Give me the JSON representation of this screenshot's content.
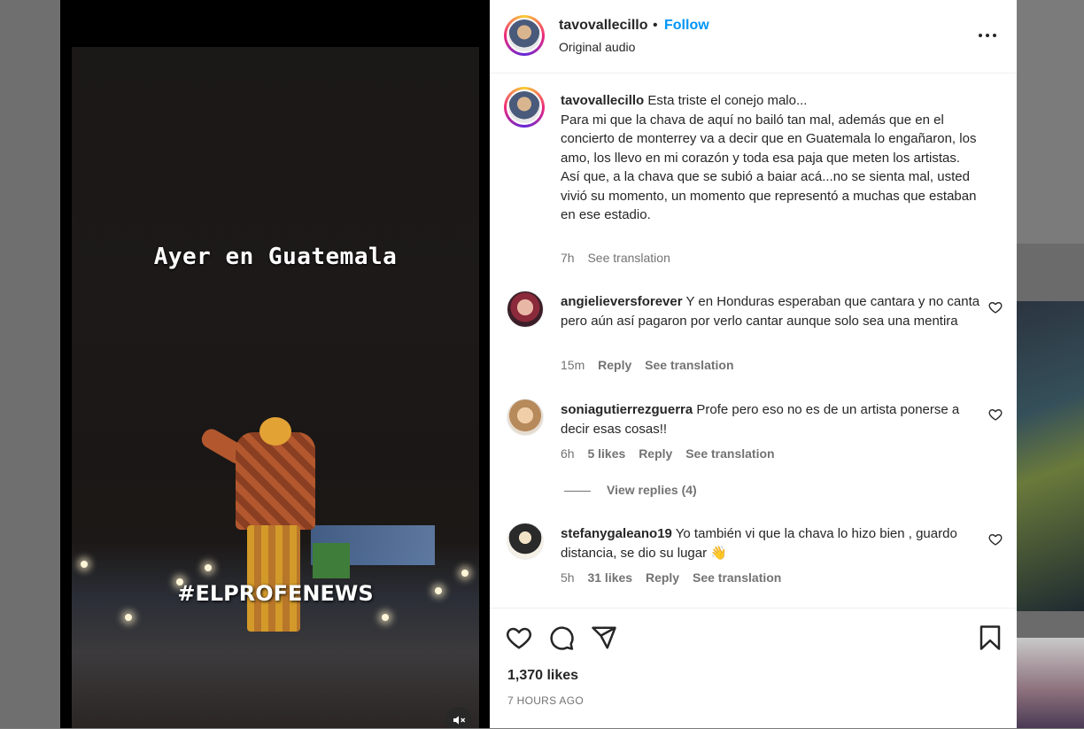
{
  "video": {
    "title_text": "Ayer en Guatemala",
    "hashtag_text": "#ELPROFENEWS"
  },
  "header": {
    "username": "tavovallecillo",
    "separator": "•",
    "follow_label": "Follow",
    "audio": "Original audio"
  },
  "caption": {
    "username": "tavovallecillo",
    "text_line1": "Esta triste el conejo malo...",
    "text_rest": "Para mi que la chava de aquí no bailó tan mal, además que en el concierto de monterrey va a decir que en Guatemala lo engañaron, los amo, los llevo en mi corazón y toda esa paja que meten los artistas.",
    "text_rest2": "Así que, a la chava que se subió a baiar acá...no se sienta mal, usted vivió su momento, un momento que representó a muchas que estaban en ese estadio.",
    "time": "7h",
    "see_translation": "See translation"
  },
  "comments": [
    {
      "username": "angielieversforever",
      "text": "Y en Honduras esperaban que cantara y no canta pero aún así pagaron por verlo cantar aunque solo sea una mentira",
      "time": "15m",
      "likes": "",
      "reply": "Reply",
      "see_translation": "See translation"
    },
    {
      "username": "soniagutierrezguerra",
      "text": "Profe pero eso no es de un artista ponerse a decir esas cosas!!",
      "time": "6h",
      "likes": "5 likes",
      "reply": "Reply",
      "see_translation": "See translation"
    },
    {
      "username": "stefanygaleano19",
      "text": "Yo también vi que la chava lo hizo bien , guardo distancia, se dio su lugar 👋",
      "time": "5h",
      "likes": "31 likes",
      "reply": "Reply",
      "see_translation": "See translation"
    }
  ],
  "view_replies": "View replies (4)",
  "footer": {
    "likes": "1,370 likes",
    "posted": "7 HOURS AGO"
  },
  "icons": {
    "more": "more-options-icon",
    "heart": "heart-icon",
    "comment": "comment-icon",
    "share": "send-icon",
    "save": "bookmark-icon",
    "mute": "speaker-muted-icon"
  },
  "colors": {
    "follow": "#0095f6",
    "text": "#262626",
    "secondary": "#737373"
  }
}
